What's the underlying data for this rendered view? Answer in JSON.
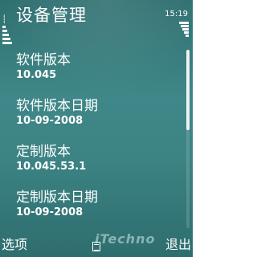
{
  "header": {
    "title": "设备管理",
    "clock": "15:19"
  },
  "info_items": [
    {
      "label": "软件版本",
      "value": "10.045"
    },
    {
      "label": "软件版本日期",
      "value": "10-09-2008"
    },
    {
      "label": "定制版本",
      "value": "10.045.53.1"
    },
    {
      "label": "定制版本日期",
      "value": "10-09-2008"
    }
  ],
  "softkeys": {
    "left": "选项",
    "middle_icon": "menu-icon",
    "right": "退出"
  },
  "watermark": "iTechno",
  "colors": {
    "background": "#3c8384",
    "text": "#ffffff"
  }
}
